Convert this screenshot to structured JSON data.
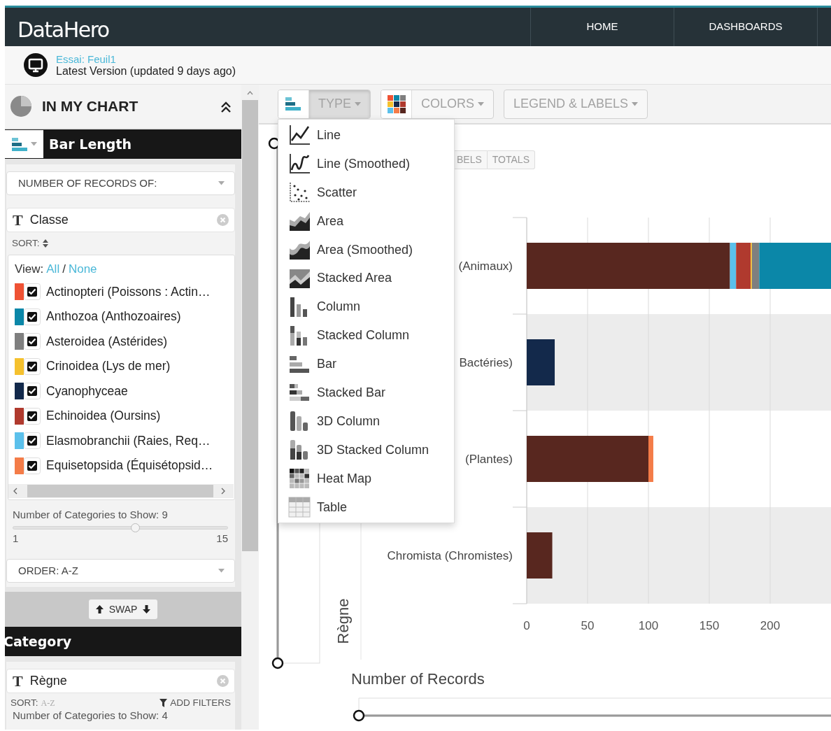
{
  "navbar": {
    "logo": "DataHero",
    "links": [
      {
        "label": "HOME"
      },
      {
        "label": "DASHBOARDS"
      }
    ]
  },
  "dataset": {
    "name": "Essai: Feuil1",
    "version": "Latest Version (updated 9 days ago)"
  },
  "sidebar": {
    "title": "IN MY CHART",
    "bar_length": {
      "heading": "Bar Length",
      "measure": "NUMBER OF RECORDS OF:",
      "field": {
        "type_symbol": "T",
        "name": "Classe"
      },
      "sort": "SORT:",
      "view_label": "View:",
      "view_all": "All",
      "view_separator": "/",
      "view_none": "None",
      "legend": [
        {
          "name": "Actinopteri (Poissons : Actin…",
          "color": "#ef5234",
          "checked": true
        },
        {
          "name": "Anthozoa (Anthozoaires)",
          "color": "#0b87a8",
          "checked": true
        },
        {
          "name": "Asteroidea (Astérides)",
          "color": "#7f7f7f",
          "checked": true
        },
        {
          "name": "Crinoidea (Lys de mer)",
          "color": "#f5c12e",
          "checked": true
        },
        {
          "name": "Cyanophyceae",
          "color": "#13294b",
          "checked": true
        },
        {
          "name": "Echinoidea (Oursins)",
          "color": "#b03a2e",
          "checked": true
        },
        {
          "name": "Elasmobranchii (Raies, Req…",
          "color": "#5bc0eb",
          "checked": true
        },
        {
          "name": "Equisetopsida (Équisétopsid…",
          "color": "#f47c48",
          "checked": true
        }
      ],
      "categories_label": "Number of Categories to Show: 9",
      "slider": {
        "level": 0.57,
        "min": "1",
        "max": "15"
      },
      "order": "ORDER: A-Z"
    },
    "swap": "SWAP",
    "category": {
      "heading": "Category",
      "field": {
        "type_symbol": "T",
        "name": "Règne"
      },
      "sort": "SORT:",
      "sort_value": "A-Z",
      "add_filters": "ADD FILTERS",
      "categories_label": "Number of Categories to Show: 4"
    }
  },
  "toolbar": [
    {
      "kind": "type",
      "label": "TYPE",
      "expanded": true
    },
    {
      "kind": "colors",
      "label": "COLORS",
      "expanded": false
    },
    {
      "kind": "legend",
      "label": "LEGEND & LABELS",
      "expanded": false
    }
  ],
  "type_menu": [
    {
      "label": "Line",
      "kind": "line"
    },
    {
      "label": "Line (Smoothed)",
      "kind": "line-smooth"
    },
    {
      "label": "Scatter",
      "kind": "scatter"
    },
    {
      "label": "Area",
      "kind": "area"
    },
    {
      "label": "Area (Smoothed)",
      "kind": "area-smooth"
    },
    {
      "label": "Stacked Area",
      "kind": "stacked-area"
    },
    {
      "label": "Column",
      "kind": "column"
    },
    {
      "label": "Stacked Column",
      "kind": "stacked-column"
    },
    {
      "label": "Bar",
      "kind": "bar"
    },
    {
      "label": "Stacked Bar",
      "kind": "stacked-bar"
    },
    {
      "label": "3D Column",
      "kind": "column-3d"
    },
    {
      "label": "3D Stacked Column",
      "kind": "stacked-column-3d"
    },
    {
      "label": "Heat Map",
      "kind": "heatmap"
    },
    {
      "label": "Table",
      "kind": "table"
    }
  ],
  "chart": {
    "buttons": [
      {
        "label": "BELS"
      },
      {
        "label": "TOTALS"
      }
    ],
    "chart_data": {
      "type": "bar",
      "orientation": "horizontal",
      "stacked": true,
      "xlabel": "Number of Records",
      "ylabel": "Règne",
      "categories": [
        "(Animaux)",
        "Bactéries)",
        "(Plantes)",
        "Chromista (Chromistes)"
      ],
      "series": [
        {
          "color": "#58271f",
          "values": [
            167,
            0,
            100,
            21
          ]
        },
        {
          "color": "#5bc0eb",
          "values": [
            5,
            0,
            0,
            0
          ]
        },
        {
          "color": "#b03a2e",
          "values": [
            12,
            0,
            0,
            0
          ]
        },
        {
          "color": "#f5c12e",
          "values": [
            1,
            0,
            0,
            0
          ]
        },
        {
          "color": "#7f7f7f",
          "values": [
            6,
            0,
            0,
            0
          ]
        },
        {
          "color": "#0b87a8",
          "values": [
            59,
            0,
            0,
            0
          ]
        },
        {
          "color": "#13294b",
          "values": [
            0,
            23,
            0,
            0
          ]
        },
        {
          "color": "#f47c48",
          "values": [
            0,
            0,
            4,
            0
          ]
        }
      ],
      "xlim": [
        0,
        250
      ],
      "xticks": [
        0,
        50,
        100,
        150,
        200
      ],
      "grid": true
    },
    "vertical_range": {
      "level": 1
    },
    "horizontal_range": {
      "level": 1
    }
  }
}
